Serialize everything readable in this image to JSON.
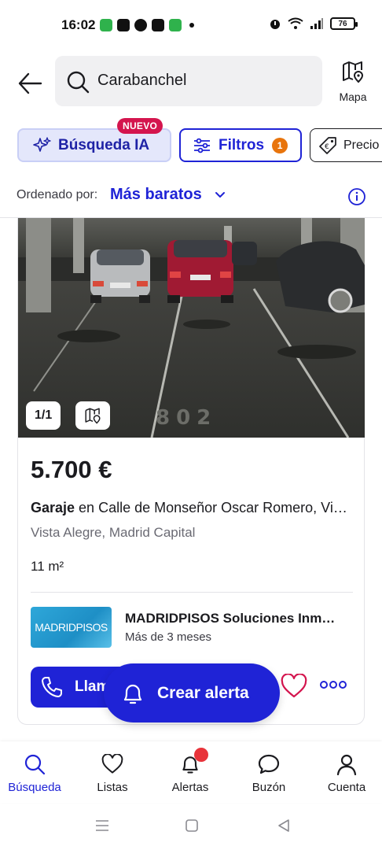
{
  "status_bar": {
    "time": "16:02",
    "battery": "76"
  },
  "search": {
    "query": "Carabanchel",
    "map_label": "Mapa"
  },
  "filters": {
    "ai_search_label": "Búsqueda IA",
    "ai_badge": "NUEVO",
    "filters_label": "Filtros",
    "filters_count": "1",
    "price_label": "Precio"
  },
  "sort": {
    "prefix": "Ordenado por:",
    "value": "Más baratos"
  },
  "listing": {
    "photo_counter": "1/1",
    "price": "5.700 €",
    "type": "Garaje",
    "address": " en Calle de Monseñor Oscar Romero, Vi…",
    "location": "Vista Alegre,  Madrid Capital",
    "area": "11 m²",
    "agency_logo_text": "MADRIDPISOS",
    "agency_name": "MADRIDPISOS Soluciones Inm…",
    "agency_since": "Más de 3 meses",
    "call_label": "Llam"
  },
  "create_alert": {
    "label": "Crear alerta"
  },
  "bottom_nav": {
    "items": [
      {
        "label": "Búsqueda"
      },
      {
        "label": "Listas"
      },
      {
        "label": "Alertas"
      },
      {
        "label": "Buzón"
      },
      {
        "label": "Cuenta"
      }
    ]
  },
  "colors": {
    "primary": "#1f23d6",
    "ai_chip_bg": "#e4e7fb",
    "badge_new": "#d4154e",
    "count_badge": "#e8740c",
    "alert_dot": "#e8333a"
  }
}
